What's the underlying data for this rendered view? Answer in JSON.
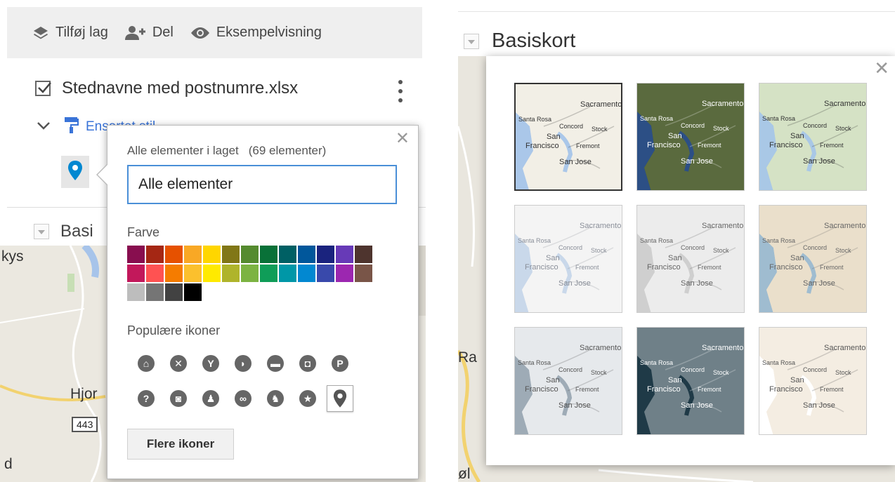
{
  "toolbar": {
    "add_layer": "Tilføj lag",
    "share": "Del",
    "preview": "Eksempelvisning"
  },
  "layer": {
    "name": "Stednavne med postnumre.xlsx",
    "style_label": "Ensartet stil"
  },
  "basemap_section": {
    "label_left": "Basi",
    "label_right": "Basiskort"
  },
  "map_left": {
    "place_1": "kys",
    "place_2": "Hjor",
    "road_badge": "443",
    "place_3": "d"
  },
  "map_right": {
    "place_1": "Ra",
    "place_2": "øl"
  },
  "style_popup": {
    "heading": "Alle elementer i laget",
    "count": "(69 elementer)",
    "name_value": "Alle elementer",
    "color_label": "Farve",
    "colors": [
      "#880e4f",
      "#a52714",
      "#e65100",
      "#f9a825",
      "#ffd600",
      "#817717",
      "#558b2f",
      "#097138",
      "#006064",
      "#01579b",
      "#1a237e",
      "#673ab7",
      "#4e342e",
      "#c2185b",
      "#ff5252",
      "#f57c00",
      "#fbc02d",
      "#ffea00",
      "#afb42b",
      "#7cb342",
      "#0f9d58",
      "#0097a7",
      "#0288d1",
      "#3949ab",
      "#9c27b0",
      "#795548",
      "#bdbdbd",
      "#757575",
      "#424242",
      "#000000"
    ],
    "popular_icons_label": "Populære ikoner",
    "icons": [
      {
        "name": "home-icon",
        "glyph": "⌂"
      },
      {
        "name": "restaurant-icon",
        "glyph": "✕"
      },
      {
        "name": "bar-icon",
        "glyph": "Y"
      },
      {
        "name": "cafe-icon",
        "glyph": "◗"
      },
      {
        "name": "hotel-icon",
        "glyph": "▬"
      },
      {
        "name": "shopping-icon",
        "glyph": "◘"
      },
      {
        "name": "parking-icon",
        "glyph": "P"
      },
      {
        "name": "help-icon",
        "glyph": "?"
      },
      {
        "name": "camera-icon",
        "glyph": "◙"
      },
      {
        "name": "hiking-icon",
        "glyph": "♟"
      },
      {
        "name": "cycling-icon",
        "glyph": "∞"
      },
      {
        "name": "running-icon",
        "glyph": "♞"
      },
      {
        "name": "star-icon",
        "glyph": "★"
      },
      {
        "name": "place-marker-icon",
        "glyph": "⬤"
      }
    ],
    "more_icons": "Flere ikoner"
  },
  "basemaps": {
    "tiles": [
      {
        "name": "basemap-map",
        "bg": "#dfe4e8",
        "water": "#aac7e9",
        "land": "#f2efe6",
        "text": "#333333",
        "selected": true
      },
      {
        "name": "basemap-satellite",
        "bg": "#3b5530",
        "water": "#2c4f85",
        "land": "#5a6a3e",
        "text": "#ffffff",
        "selected": false
      },
      {
        "name": "basemap-terrain",
        "bg": "#cfdcc1",
        "water": "#a9c8e6",
        "land": "#d5e2c5",
        "text": "#333333",
        "selected": false
      },
      {
        "name": "basemap-light-political",
        "bg": "#eef0f3",
        "water": "#c9d8ea",
        "land": "#f4f4f4",
        "text": "#8a8f99",
        "selected": false
      },
      {
        "name": "basemap-mono-city",
        "bg": "#e4e4e4",
        "water": "#cfcfcf",
        "land": "#ececec",
        "text": "#666666",
        "selected": false
      },
      {
        "name": "basemap-simple-atlas",
        "bg": "#e8dcc6",
        "water": "#9fbcd0",
        "land": "#eadfcb",
        "text": "#666666",
        "selected": false
      },
      {
        "name": "basemap-light-landmass",
        "bg": "#dfe3e6",
        "water": "#9eabb6",
        "land": "#e6e9ec",
        "text": "#555555",
        "selected": false
      },
      {
        "name": "basemap-dark-landmass",
        "bg": "#3e5561",
        "water": "#1f3a47",
        "land": "#6f8088",
        "text": "#ffffff",
        "selected": false
      },
      {
        "name": "basemap-whitewater",
        "bg": "#f6f1ea",
        "water": "#ffffff",
        "land": "#f4ede2",
        "text": "#555555",
        "selected": false
      }
    ],
    "labels": {
      "city_1": "Sacramento",
      "city_2": "Santa Rosa",
      "city_3": "San",
      "city_4": "Francisco",
      "city_5": "San Jose",
      "city_6": "Fremont",
      "city_7": "Concord",
      "city_8": "Stock"
    }
  }
}
